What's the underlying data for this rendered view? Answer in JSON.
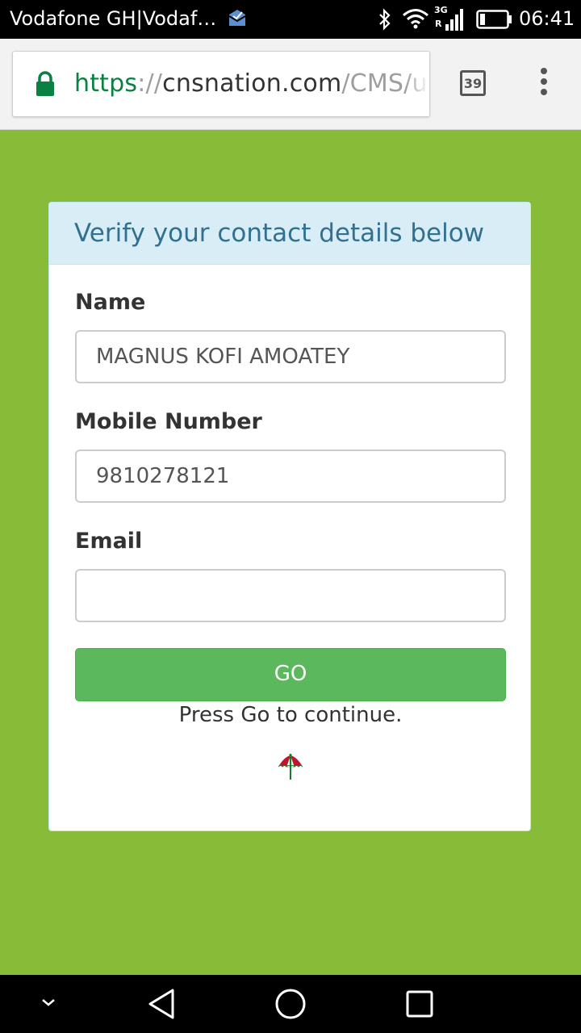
{
  "status_bar": {
    "carrier": "Vodafone GH|Vodaf…",
    "network_type": "3G",
    "roaming": "R",
    "time": "06:41",
    "icons": [
      "mail-icon",
      "bluetooth-icon",
      "wifi-icon",
      "signal-icon",
      "battery-icon"
    ]
  },
  "browser": {
    "url_scheme": "https",
    "url_separator": "://",
    "url_host": "cnsnation.com",
    "url_path": "/CMS/u",
    "tab_count": "39",
    "icons": [
      "lock-icon",
      "tabs-icon",
      "overflow-menu-icon"
    ]
  },
  "form": {
    "title": "Verify your contact details below",
    "name_label": "Name",
    "name_value": "MAGNUS KOFI AMOATEY",
    "mobile_label": "Mobile Number",
    "mobile_value": "9810278121",
    "email_label": "Email",
    "email_value": "",
    "go_label": "GO",
    "hint": "Press Go to continue.",
    "logo_icon": "umbrella-logo-icon"
  },
  "colors": {
    "page_background": "#88bb38",
    "panel_heading_bg": "#d9edf7",
    "panel_title_color": "#31708f",
    "go_button": "#5cb85c",
    "url_scheme_color": "#0b8043"
  },
  "nav_bar": {
    "icons": [
      "chevron-down-icon",
      "back-icon",
      "home-icon",
      "recents-icon"
    ]
  }
}
